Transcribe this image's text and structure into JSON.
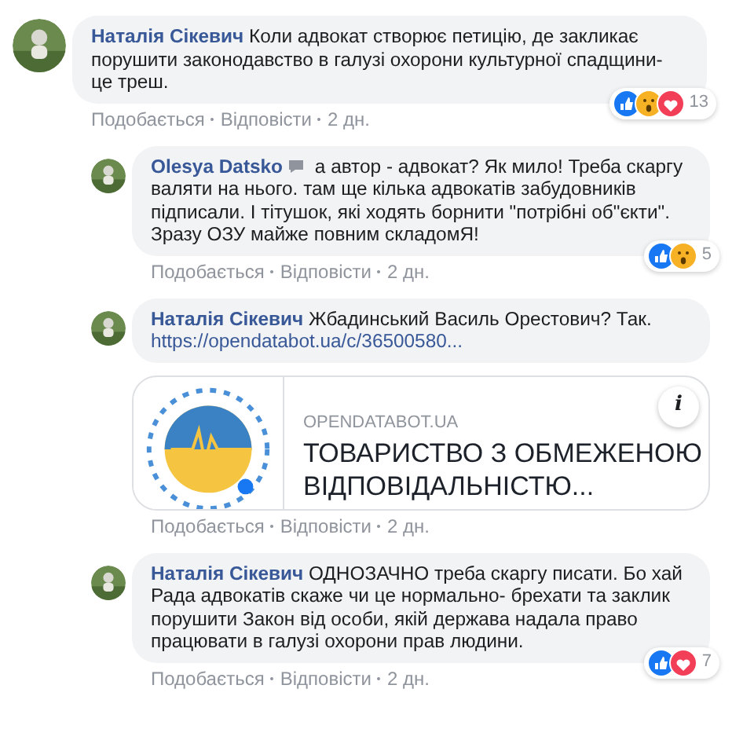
{
  "comments": [
    {
      "kind": "main",
      "author": "Наталія Сікевич",
      "badge": false,
      "text": "Коли адвокат створює петицію, де закликає порушити законодавство в галузі охорони культурної спадщини- це треш.",
      "reactions": [
        {
          "kind": "like"
        },
        {
          "kind": "wow"
        },
        {
          "kind": "love"
        }
      ],
      "count": "13",
      "actions": [
        "Подобається",
        "Відповісти",
        "2 дн."
      ]
    },
    {
      "kind": "reply",
      "author": "Olesya Datsko",
      "badge": true,
      "text": "а автор - адвокат? Як мило! Треба скаргу валяти на нього. там ще кілька адвокатів забудовників підписали. І тітушок, які ходять борнити \"потрібні об\"єкти\". Зразу ОЗУ майже повним складомЯ!",
      "reactions": [
        {
          "kind": "like"
        },
        {
          "kind": "wow"
        }
      ],
      "count": "5",
      "actions": [
        "Подобається",
        "Відповісти",
        "2 дн."
      ]
    },
    {
      "kind": "reply",
      "author": "Наталія Сікевич",
      "badge": false,
      "text": "Жбадинський Василь Орестович? Так.",
      "link": "https://opendatabot.ua/c/36500580...",
      "card": {
        "domain": "OPENDATABOT.UA",
        "title": "ТОВАРИСТВО З ОБМЕЖЕНОЮ ВІДПОВІДАЛЬНІСТЮ...",
        "info": "i"
      },
      "actions": [
        "Подобається",
        "Відповісти",
        "2 дн."
      ]
    },
    {
      "kind": "reply",
      "author": "Наталія Сікевич",
      "badge": false,
      "text": "ОДНОЗАЧНО треба скаргу писати. Бо хай Рада адвокатів скаже чи це нормально- брехати та заклик порушити Закон від особи, якій держава надала право працювати в галузі охорони прав людини.",
      "reactions": [
        {
          "kind": "like"
        },
        {
          "kind": "love"
        }
      ],
      "count": "7",
      "actions": [
        "Подобається",
        "Відповісти",
        "2 дн."
      ]
    }
  ]
}
